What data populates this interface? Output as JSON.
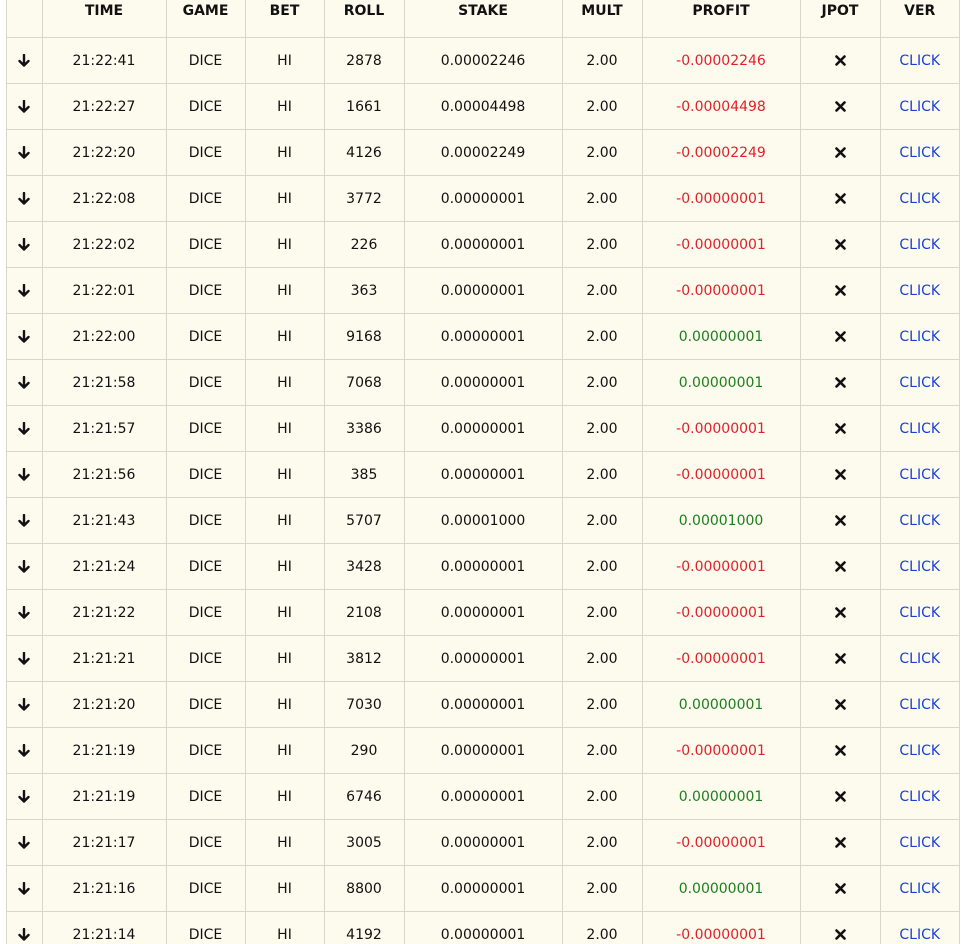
{
  "colors": {
    "background": "#fdfbee",
    "border": "#d8d6c8",
    "loss": "#e0202a",
    "win": "#1e7e1e",
    "link": "#1a3fd6"
  },
  "icons": {
    "row_expand": "arrow-down-icon",
    "jackpot_none": "cross-icon"
  },
  "columns": [
    "",
    "TIME",
    "GAME",
    "BET",
    "ROLL",
    "STAKE",
    "MULT",
    "PROFIT",
    "JPOT",
    "VER"
  ],
  "rows": [
    {
      "time": "21:22:41",
      "game": "DICE",
      "bet": "HI",
      "roll": "2878",
      "stake": "0.00002246",
      "mult": "2.00",
      "profit": "-0.00002246",
      "result": "loss",
      "ver": "CLICK"
    },
    {
      "time": "21:22:27",
      "game": "DICE",
      "bet": "HI",
      "roll": "1661",
      "stake": "0.00004498",
      "mult": "2.00",
      "profit": "-0.00004498",
      "result": "loss",
      "ver": "CLICK"
    },
    {
      "time": "21:22:20",
      "game": "DICE",
      "bet": "HI",
      "roll": "4126",
      "stake": "0.00002249",
      "mult": "2.00",
      "profit": "-0.00002249",
      "result": "loss",
      "ver": "CLICK"
    },
    {
      "time": "21:22:08",
      "game": "DICE",
      "bet": "HI",
      "roll": "3772",
      "stake": "0.00000001",
      "mult": "2.00",
      "profit": "-0.00000001",
      "result": "loss",
      "ver": "CLICK"
    },
    {
      "time": "21:22:02",
      "game": "DICE",
      "bet": "HI",
      "roll": "226",
      "stake": "0.00000001",
      "mult": "2.00",
      "profit": "-0.00000001",
      "result": "loss",
      "ver": "CLICK"
    },
    {
      "time": "21:22:01",
      "game": "DICE",
      "bet": "HI",
      "roll": "363",
      "stake": "0.00000001",
      "mult": "2.00",
      "profit": "-0.00000001",
      "result": "loss",
      "ver": "CLICK"
    },
    {
      "time": "21:22:00",
      "game": "DICE",
      "bet": "HI",
      "roll": "9168",
      "stake": "0.00000001",
      "mult": "2.00",
      "profit": "0.00000001",
      "result": "win",
      "ver": "CLICK"
    },
    {
      "time": "21:21:58",
      "game": "DICE",
      "bet": "HI",
      "roll": "7068",
      "stake": "0.00000001",
      "mult": "2.00",
      "profit": "0.00000001",
      "result": "win",
      "ver": "CLICK"
    },
    {
      "time": "21:21:57",
      "game": "DICE",
      "bet": "HI",
      "roll": "3386",
      "stake": "0.00000001",
      "mult": "2.00",
      "profit": "-0.00000001",
      "result": "loss",
      "ver": "CLICK"
    },
    {
      "time": "21:21:56",
      "game": "DICE",
      "bet": "HI",
      "roll": "385",
      "stake": "0.00000001",
      "mult": "2.00",
      "profit": "-0.00000001",
      "result": "loss",
      "ver": "CLICK"
    },
    {
      "time": "21:21:43",
      "game": "DICE",
      "bet": "HI",
      "roll": "5707",
      "stake": "0.00001000",
      "mult": "2.00",
      "profit": "0.00001000",
      "result": "win",
      "ver": "CLICK"
    },
    {
      "time": "21:21:24",
      "game": "DICE",
      "bet": "HI",
      "roll": "3428",
      "stake": "0.00000001",
      "mult": "2.00",
      "profit": "-0.00000001",
      "result": "loss",
      "ver": "CLICK"
    },
    {
      "time": "21:21:22",
      "game": "DICE",
      "bet": "HI",
      "roll": "2108",
      "stake": "0.00000001",
      "mult": "2.00",
      "profit": "-0.00000001",
      "result": "loss",
      "ver": "CLICK"
    },
    {
      "time": "21:21:21",
      "game": "DICE",
      "bet": "HI",
      "roll": "3812",
      "stake": "0.00000001",
      "mult": "2.00",
      "profit": "-0.00000001",
      "result": "loss",
      "ver": "CLICK"
    },
    {
      "time": "21:21:20",
      "game": "DICE",
      "bet": "HI",
      "roll": "7030",
      "stake": "0.00000001",
      "mult": "2.00",
      "profit": "0.00000001",
      "result": "win",
      "ver": "CLICK"
    },
    {
      "time": "21:21:19",
      "game": "DICE",
      "bet": "HI",
      "roll": "290",
      "stake": "0.00000001",
      "mult": "2.00",
      "profit": "-0.00000001",
      "result": "loss",
      "ver": "CLICK"
    },
    {
      "time": "21:21:19",
      "game": "DICE",
      "bet": "HI",
      "roll": "6746",
      "stake": "0.00000001",
      "mult": "2.00",
      "profit": "0.00000001",
      "result": "win",
      "ver": "CLICK"
    },
    {
      "time": "21:21:17",
      "game": "DICE",
      "bet": "HI",
      "roll": "3005",
      "stake": "0.00000001",
      "mult": "2.00",
      "profit": "-0.00000001",
      "result": "loss",
      "ver": "CLICK"
    },
    {
      "time": "21:21:16",
      "game": "DICE",
      "bet": "HI",
      "roll": "8800",
      "stake": "0.00000001",
      "mult": "2.00",
      "profit": "0.00000001",
      "result": "win",
      "ver": "CLICK"
    },
    {
      "time": "21:21:14",
      "game": "DICE",
      "bet": "HI",
      "roll": "4192",
      "stake": "0.00000001",
      "mult": "2.00",
      "profit": "-0.00000001",
      "result": "loss",
      "ver": "CLICK"
    }
  ]
}
